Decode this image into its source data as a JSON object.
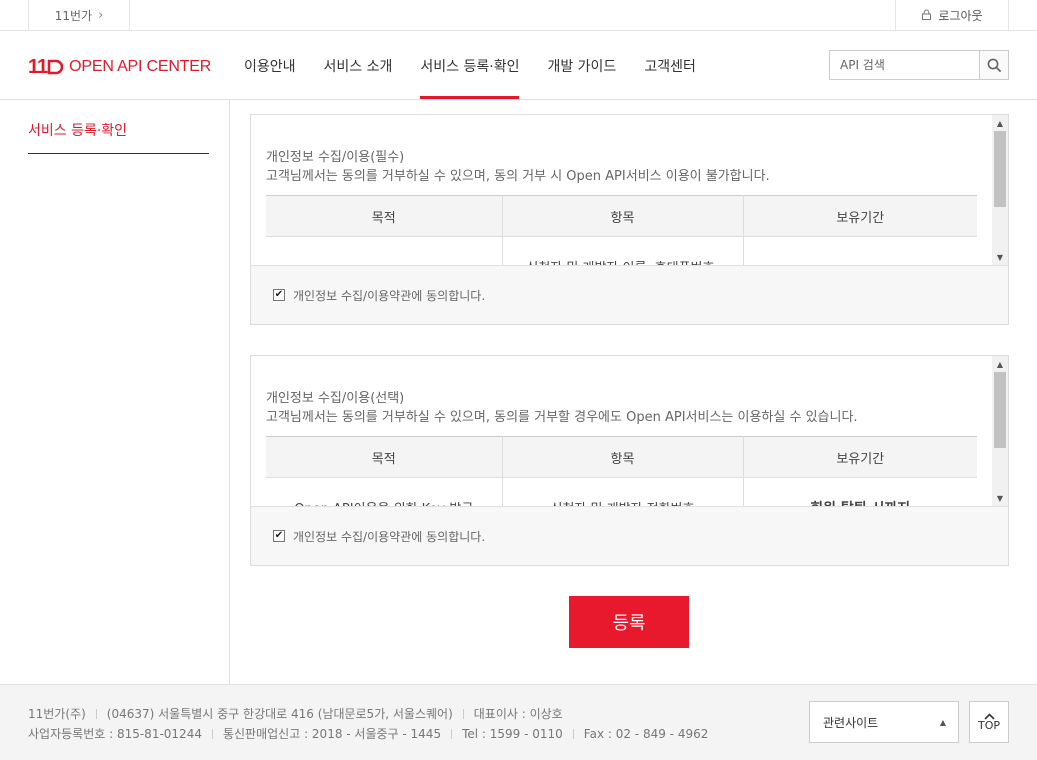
{
  "topbar": {
    "site_link": "11번가",
    "logout": "로그아웃"
  },
  "header": {
    "logo_mark": "11",
    "brand": "OPEN API CENTER",
    "tabs": [
      {
        "label": "이용안내",
        "active": false
      },
      {
        "label": "서비스 소개",
        "active": false
      },
      {
        "label": "서비스 등록·확인",
        "active": true
      },
      {
        "label": "개발 가이드",
        "active": false
      },
      {
        "label": "고객센터",
        "active": false
      }
    ],
    "search_placeholder": "API 검색"
  },
  "sidebar": {
    "items": [
      {
        "label": "서비스 등록·확인",
        "active": true
      }
    ]
  },
  "consent_required": {
    "title": "개인정보 수집/이용(필수)",
    "description": "고객님께서는 동의를 거부하실 수 있으며, 동의 거부 시 Open API서비스 이용이 불가합니다.",
    "columns": [
      "목적",
      "항목",
      "보유기간"
    ],
    "rows": [
      [
        "",
        "신청자 및 개발자 이름, 휴대폰번호,",
        ""
      ]
    ],
    "agree_label": "개인정보 수집/이용약관에 동의합니다.",
    "checked": true
  },
  "consent_optional": {
    "title": "개인정보 수집/이용(선택)",
    "description": "고객님께서는 동의를 거부하실 수 있으며, 동의를 거부할 경우에도 Open API서비스는 이용하실 수 있습니다.",
    "columns": [
      "목적",
      "항목",
      "보유기간"
    ],
    "rows": [
      [
        "Open API이용을 위한 Key 발급",
        "신청자 및 개발자 전화번호",
        "회원 탈퇴 시까지"
      ]
    ],
    "agree_label": "개인정보 수집/이용약관에 동의합니다.",
    "checked": true
  },
  "register_button": "등록",
  "footer": {
    "line1": [
      "11번가(주)",
      "(04637) 서울특별시 중구 한강대로 416 (남대문로5가, 서울스퀘어)",
      "대표이사 : 이상호"
    ],
    "line2": [
      "사업자등록번호 : 815-81-01244",
      "통신판매업신고 : 2018 - 서울중구 - 1445",
      "Tel : 1599 - 0110",
      "Fax : 02 - 849 - 4962"
    ],
    "related_sites": "관련사이트",
    "top_button": "TOP"
  },
  "colors": {
    "accent": "#e01a2b",
    "button": "#e8192c"
  }
}
